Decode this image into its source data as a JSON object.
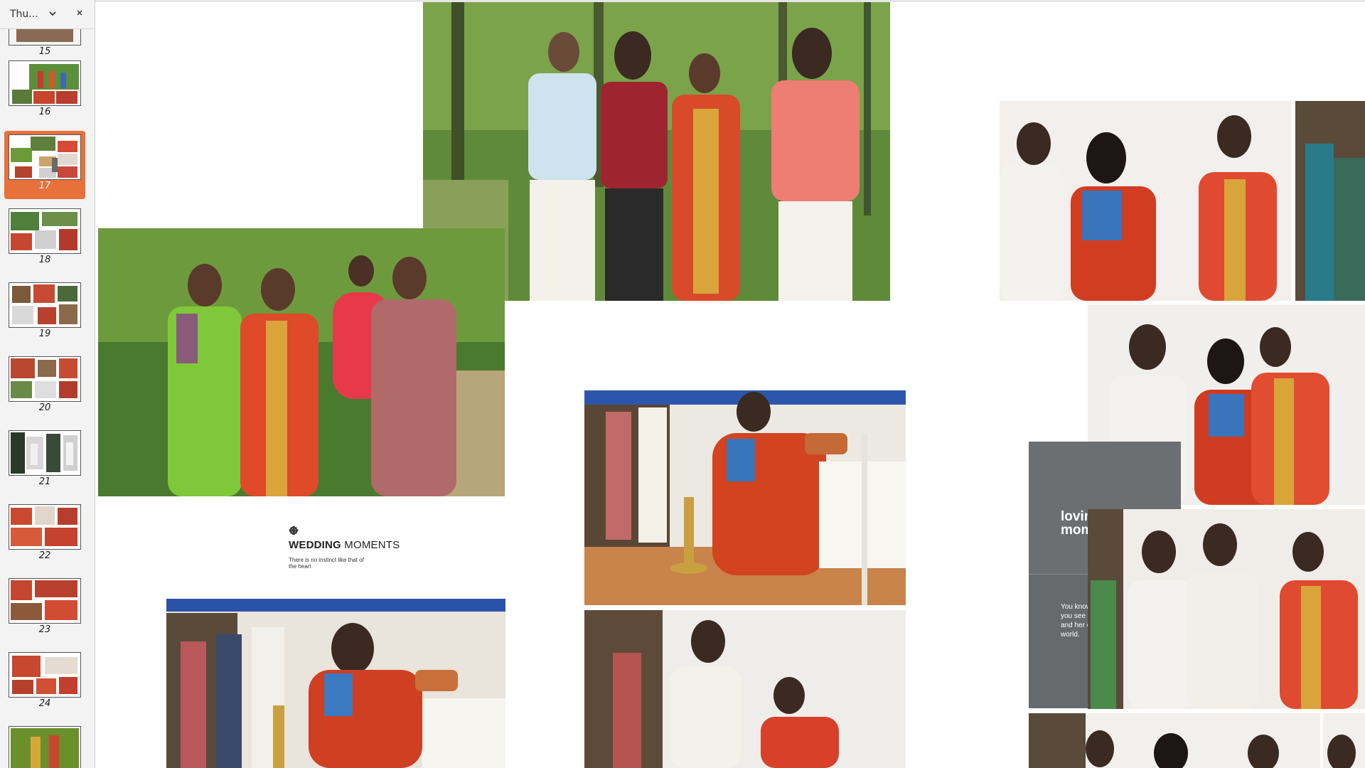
{
  "sidebar": {
    "title": "Thu...",
    "chevron_icon": "chevron-down-icon",
    "close_icon": "close-icon",
    "thumbnails": [
      {
        "page": "15"
      },
      {
        "page": "16"
      },
      {
        "page": "17",
        "active": true
      },
      {
        "page": "18"
      },
      {
        "page": "19"
      },
      {
        "page": "20"
      },
      {
        "page": "21"
      },
      {
        "page": "22"
      },
      {
        "page": "23"
      },
      {
        "page": "24"
      },
      {
        "page": ""
      }
    ],
    "active_color": "#e8703a"
  },
  "page": {
    "wedding_moments": {
      "icon": "flower-icon",
      "title_bold": "WEDDING",
      "title_rest": " MOMENTS",
      "subtitle": "There is no instinct like that of the heart"
    },
    "loving_moments": {
      "title": "loving moments",
      "text": "You know you are in love when you see the world in her eyes, and her eyes everywhere in the world."
    },
    "photos": [
      {
        "name": "group-photo-forest-four"
      },
      {
        "name": "group-photo-women-child"
      },
      {
        "name": "lamp-lighting-photo"
      },
      {
        "name": "lamp-lighting-closeup-photo"
      },
      {
        "name": "blessing-photo"
      },
      {
        "name": "elders-greeting-photo"
      },
      {
        "name": "hug-photo"
      },
      {
        "name": "gift-exchange-photo"
      }
    ]
  }
}
